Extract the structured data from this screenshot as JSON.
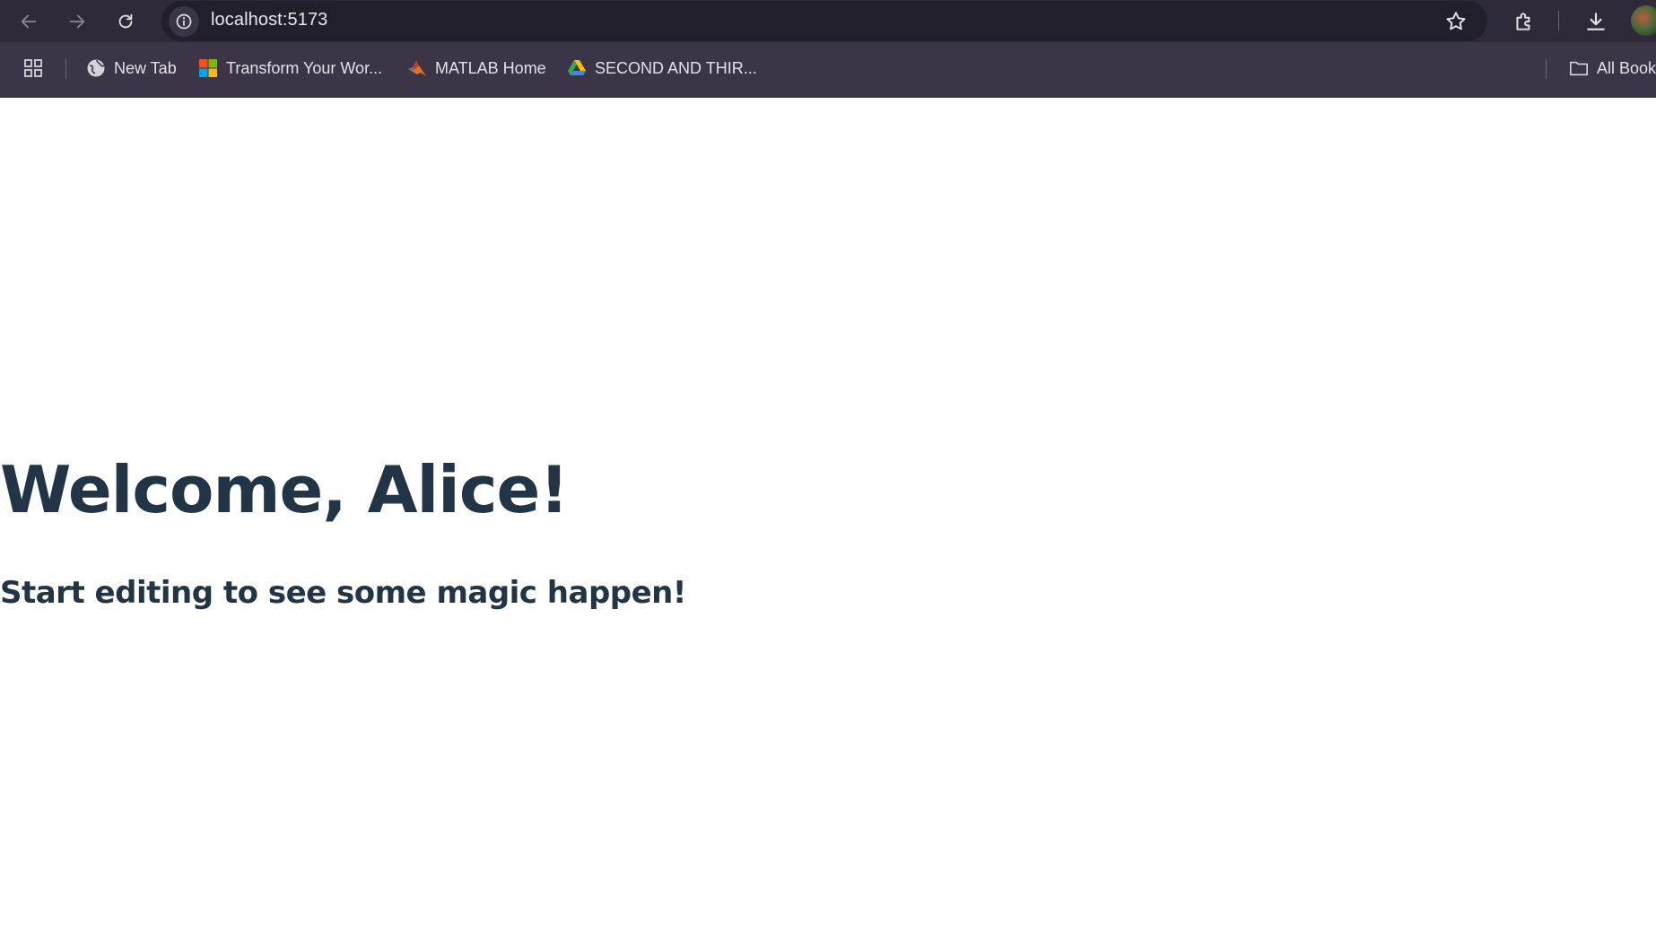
{
  "browser": {
    "url": "localhost:5173",
    "bookmarks": [
      {
        "label": "New Tab",
        "icon": "globe-icon"
      },
      {
        "label": "Transform Your Wor...",
        "icon": "microsoft-logo-icon"
      },
      {
        "label": "MATLAB Home",
        "icon": "matlab-logo-icon"
      },
      {
        "label": "SECOND AND THIR...",
        "icon": "google-drive-icon"
      }
    ],
    "all_bookmarks_label": "All Bookmarks"
  },
  "page": {
    "heading": "Welcome, Alice!",
    "subheading": "Start editing to see some magic happen!"
  },
  "colors": {
    "toolbar": "#2f2a3a",
    "bookmark_bar": "#3b3547",
    "text": "#213547"
  }
}
